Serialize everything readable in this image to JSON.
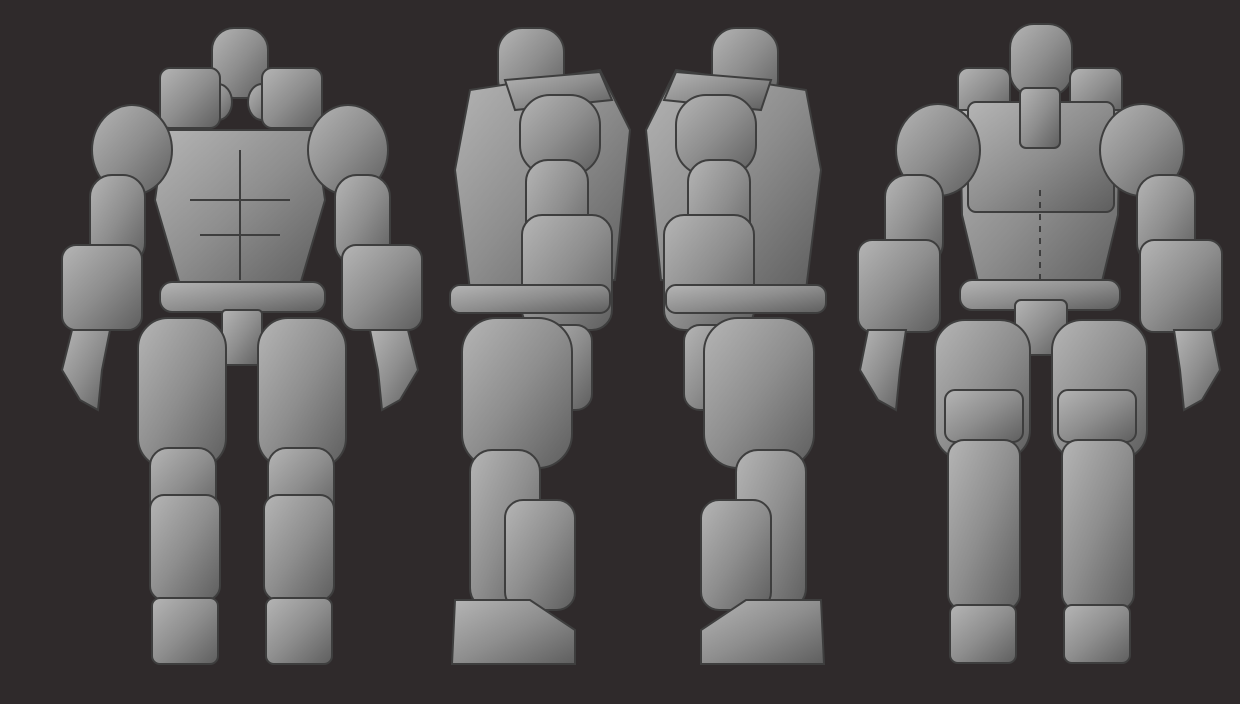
{
  "scene": {
    "background_color": "#2f2a2b",
    "clay_color": "#8e8e8e",
    "clay_highlight": "#bdbdbd",
    "clay_shadow": "#4a4a4a",
    "views": [
      {
        "id": "front",
        "icon": "armored-figure-front-icon"
      },
      {
        "id": "side-right",
        "icon": "armored-figure-side-icon"
      },
      {
        "id": "side-left",
        "icon": "armored-figure-side-icon"
      },
      {
        "id": "back",
        "icon": "armored-figure-back-icon"
      }
    ]
  }
}
